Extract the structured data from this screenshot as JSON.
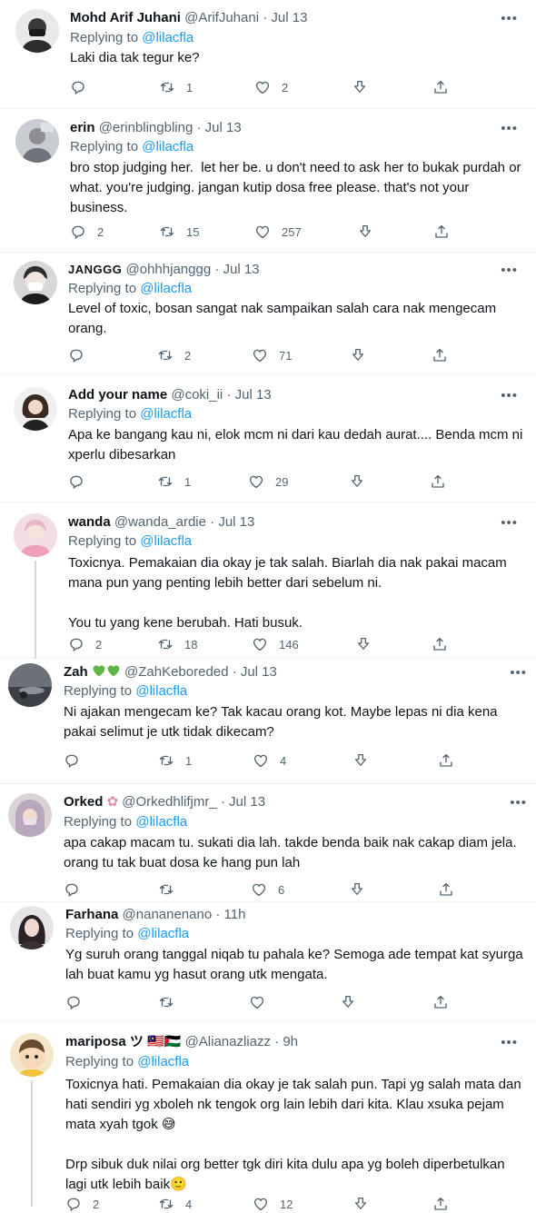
{
  "tweets": [
    {
      "name": "Mohd Arif Juhani",
      "handle": "@ArifJuhani",
      "time": "Jul 13",
      "reply_prefix": "Replying to",
      "mention": "@lilacfla",
      "text": "Laki dia tak tegur ke?",
      "replies": "",
      "retweets": "1",
      "likes": "2"
    },
    {
      "name": "erin",
      "handle": "@erinblingbling",
      "time": "Jul 13",
      "reply_prefix": "Replying to",
      "mention": "@lilacfla",
      "text": "bro stop judging her.  let her be. u don't need to ask her to bukak purdah or\nwhat. you're judging. jangan kutip dosa free please. that's not your\nbusiness.",
      "replies": "2",
      "retweets": "15",
      "likes": "257"
    },
    {
      "name": "JANGGG",
      "handle": "@ohhhjanggg",
      "time": "Jul 13",
      "reply_prefix": "Replying to",
      "mention": "@lilacfla",
      "text": "Level of toxic, bosan sangat nak sampaikan salah cara nak mengecam\norang.",
      "replies": "",
      "retweets": "2",
      "likes": "71"
    },
    {
      "name": "Add your name",
      "handle": "@coki_ii",
      "time": "Jul 13",
      "reply_prefix": "Replying to",
      "mention": "@lilacfla",
      "text": "Apa ke bangang kau ni, elok mcm ni dari kau dedah aurat.... Benda mcm ni\nxperlu dibesarkan",
      "replies": "",
      "retweets": "1",
      "likes": "29"
    },
    {
      "name": "wanda",
      "handle": "@wanda_ardie",
      "time": "Jul 13",
      "reply_prefix": "Replying to",
      "mention": "@lilacfla",
      "text": "Toxicnya. Pemakaian dia okay je tak salah. Biarlah dia nak pakai macam\nmana pun yang penting lebih better dari sebelum ni.\n\nYou tu yang kene berubah. Hati busuk.",
      "replies": "2",
      "retweets": "18",
      "likes": "146"
    },
    {
      "name": "Zah",
      "handle": "@ZahKeboreded",
      "time": "Jul 13",
      "reply_prefix": "Replying to",
      "mention": "@lilacfla",
      "text": "Ni ajakan mengecam ke? Tak kacau orang kot. Maybe lepas ni dia kena\npakai selimut je utk tidak dikecam?",
      "replies": "",
      "retweets": "1",
      "likes": "4"
    },
    {
      "name": "Orked",
      "handle": "@Orkedhlifjmr_",
      "time": "Jul 13",
      "reply_prefix": "Replying to",
      "mention": "@lilacfla",
      "text": "apa cakap macam tu. sukati dia lah. takde benda baik nak cakap diam jela.\norang tu tak buat dosa ke hang pun lah",
      "replies": "",
      "retweets": "",
      "likes": "6"
    },
    {
      "name": "Farhana",
      "handle": "@nananenano",
      "time": "11h",
      "reply_prefix": "Replying to",
      "mention": "@lilacfla",
      "text": "Yg suruh orang tanggal niqab tu pahala ke? Semoga ade tempat kat syurga\nlah buat kamu yg hasut orang utk mengata.",
      "replies": "",
      "retweets": "",
      "likes": ""
    },
    {
      "name": "mariposa ツ 🇲🇾🇵🇸",
      "handle": "@Alianazliazz",
      "time": "9h",
      "reply_prefix": "Replying to",
      "mention": "@lilacfla",
      "text": "Toxicnya hati. Pemakaian dia okay je tak salah pun. Tapi yg salah mata dan\nhati sendiri yg xboleh nk tengok org lain lebih dari kita. Klau xsuka pejam\nmata xyah tgok 😅\n\nDrp sibuk duk nilai org better tgk diri kita dulu apa yg boleh diperbetulkan\nlagi utk lebih baik🙂",
      "replies": "2",
      "retweets": "4",
      "likes": "12"
    }
  ],
  "icons": {
    "reply": "reply-icon",
    "retweet": "retweet-icon",
    "like": "heart-icon",
    "download": "download-icon",
    "share": "share-icon",
    "more": "more-icon"
  },
  "colors": {
    "mention": "#1d9bf0",
    "muted": "#536471",
    "green_heart": "#5fb548"
  }
}
